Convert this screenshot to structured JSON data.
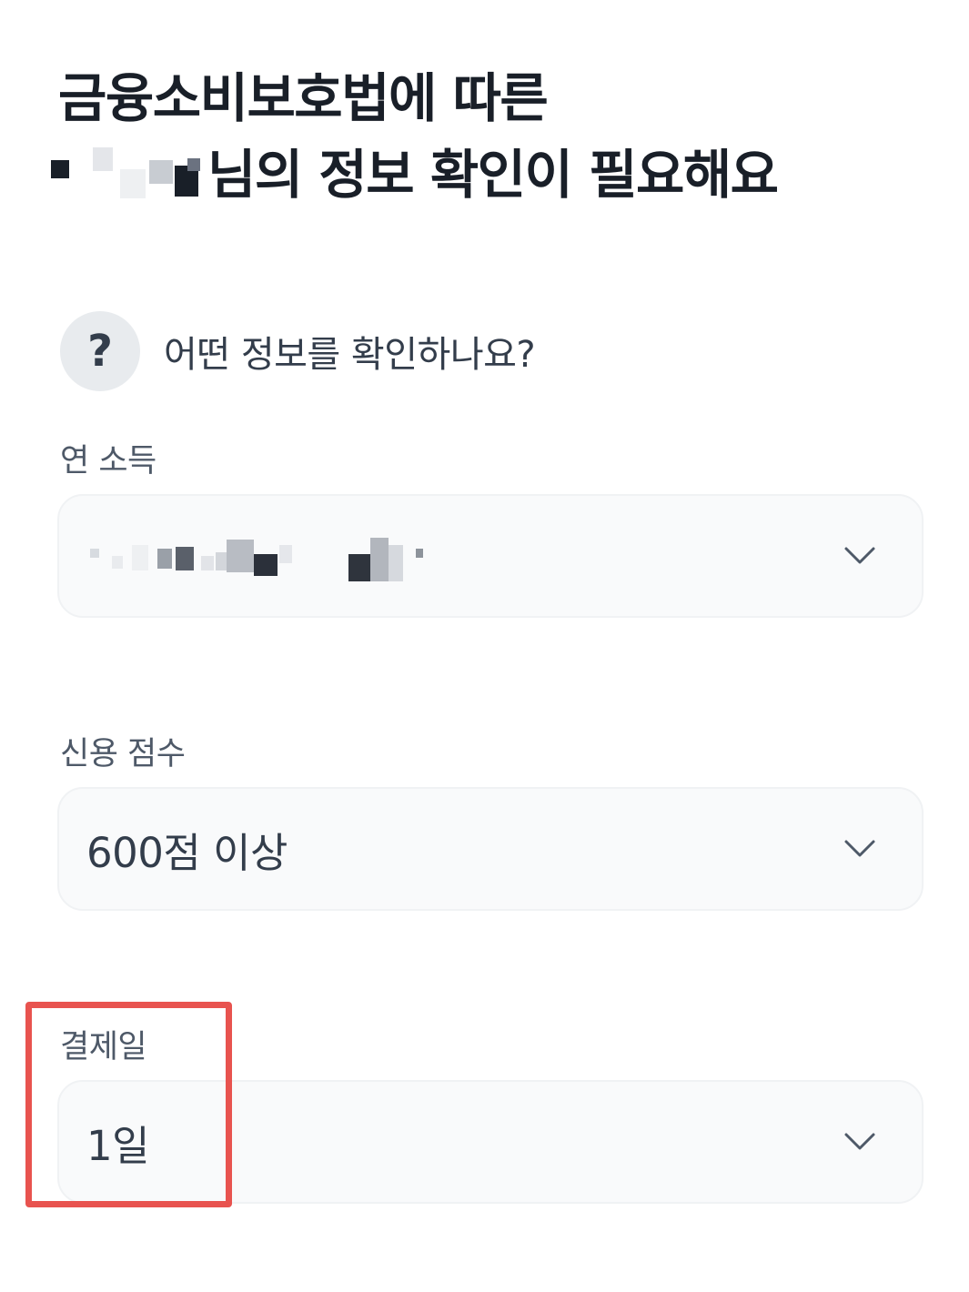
{
  "header": {
    "title_line1": "금융소비보호법에 따른",
    "title_line2_suffix": "님의 정보 확인이 필요해요"
  },
  "info": {
    "badge": "?",
    "text": "어떤 정보를 확인하나요?"
  },
  "fields": [
    {
      "label": "연 소득",
      "value": ""
    },
    {
      "label": "신용 점수",
      "value": "600점 이상"
    },
    {
      "label": "결제일",
      "value": "1일"
    }
  ],
  "colors": {
    "highlight": "#e8534f",
    "field_background": "#f9fafb",
    "badge_background": "#e8ebee"
  }
}
